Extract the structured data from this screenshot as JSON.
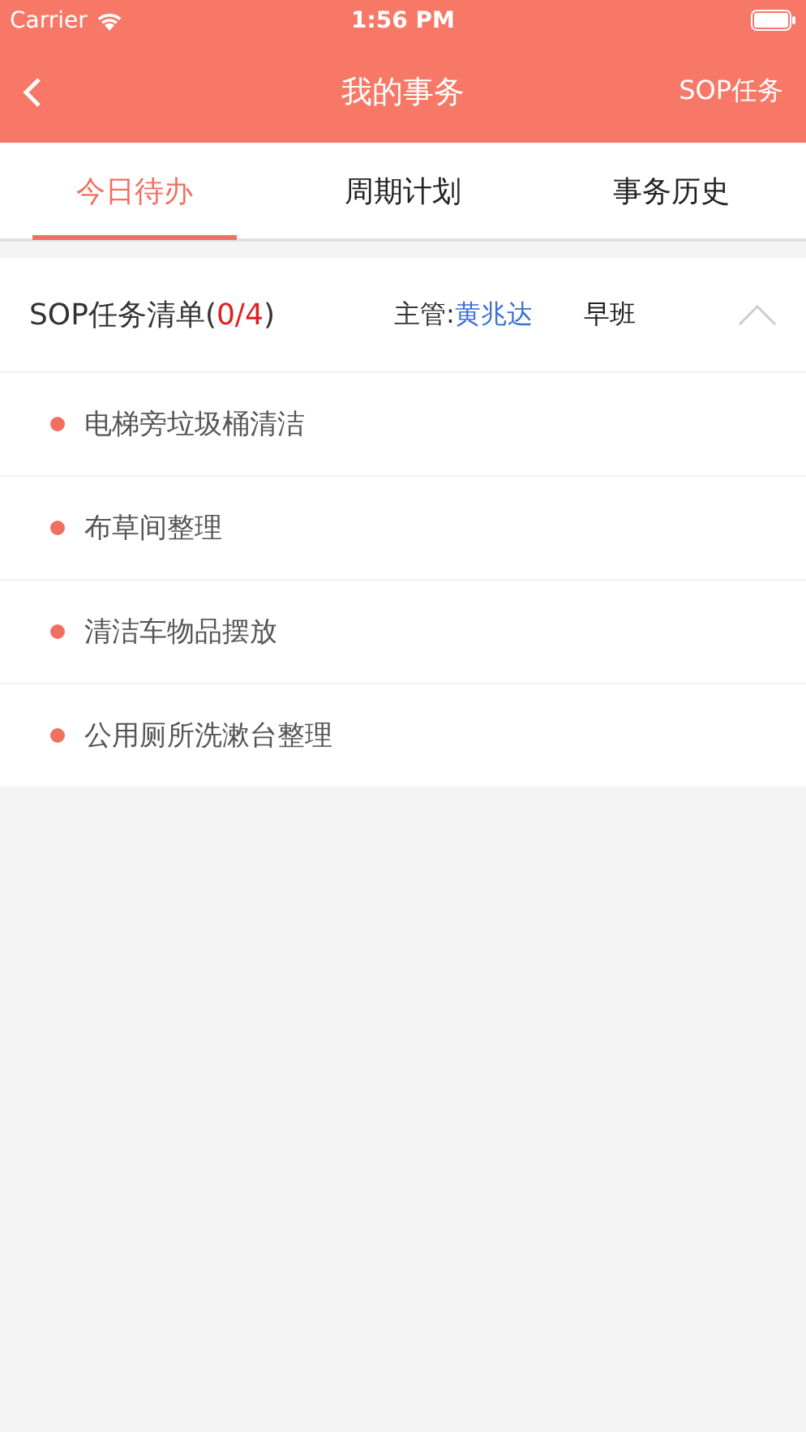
{
  "status_bar": {
    "carrier": "Carrier",
    "time": "1:56 PM"
  },
  "nav_bar": {
    "title": "我的事务",
    "action": "SOP任务"
  },
  "tabs": [
    {
      "label": "今日待办",
      "selected": true
    },
    {
      "label": "周期计划",
      "selected": false
    },
    {
      "label": "事务历史",
      "selected": false
    }
  ],
  "task_list": {
    "title_prefix": "SOP任务清单(",
    "count": "0/4",
    "title_suffix": ")",
    "supervisor_label": "主管:",
    "supervisor_name": "黄兆达",
    "shift": "早班",
    "expanded": true,
    "items": [
      {
        "label": "电梯旁垃圾桶清洁"
      },
      {
        "label": "布草间整理"
      },
      {
        "label": "清洁车物品摆放"
      },
      {
        "label": "公用厕所洗漱台整理"
      }
    ]
  }
}
